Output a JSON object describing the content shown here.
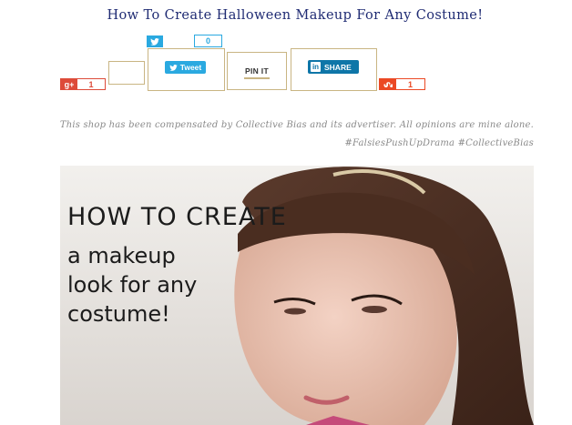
{
  "post": {
    "title": "How To Create Halloween Makeup For Any Costume!"
  },
  "share": {
    "google": {
      "badge": "g+",
      "count": "1"
    },
    "twitter": {
      "count": "0",
      "tweet_label": "Tweet"
    },
    "pinterest": {
      "label": "PIN IT"
    },
    "linkedin": {
      "logo": "in",
      "label": "SHARE"
    },
    "stumbleupon": {
      "count": "1"
    }
  },
  "disclosure": {
    "line1": "This shop has been compensated by Collective Bias and its advertiser. All opinions are mine alone.",
    "line2": "#FalsiesPushUpDrama #CollectiveBias"
  },
  "hero_image": {
    "text_line1": "HOW TO CREATE",
    "text_line2": "a makeup",
    "text_line3": "look for any",
    "text_line4": "costume!"
  },
  "colors": {
    "title": "#1f2b73",
    "google": "#dd4b39",
    "twitter": "#2aa9e0",
    "linkedin": "#0e76a8",
    "stumbleupon": "#eb4924",
    "frame_gold": "#c9b583"
  },
  "icons": [
    "twitter-bird-icon",
    "google-plus-icon",
    "stumbleupon-icon",
    "linkedin-icon"
  ]
}
